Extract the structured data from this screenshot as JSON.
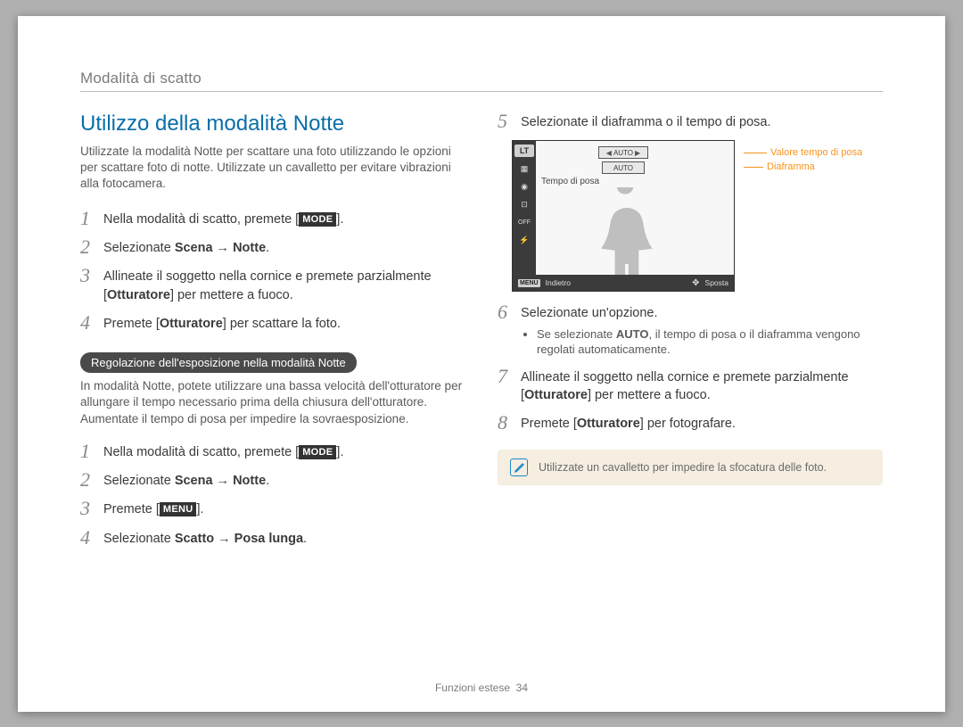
{
  "header": {
    "running_title": "Modalità di scatto"
  },
  "section": {
    "title": "Utilizzo della modalità Notte",
    "intro": "Utilizzate la modalità Notte per scattare una foto utilizzando le opzioni per scattare foto di notte. Utilizzate un cavalletto per evitare vibrazioni alla fotocamera."
  },
  "steps_a": {
    "s1": {
      "num": "1",
      "pre": "Nella modalità di scatto, premete [",
      "btn": "MODE",
      "post": "]."
    },
    "s2": {
      "num": "2",
      "pre": "Selezionate ",
      "bold": "Scena → Notte",
      "post": "."
    },
    "s3": {
      "num": "3",
      "text": "Allineate il soggetto nella cornice e premete parzialmente [",
      "bold": "Otturatore",
      "post": "] per mettere a fuoco."
    },
    "s4": {
      "num": "4",
      "pre": "Premete [",
      "bold": "Otturatore",
      "post": "] per scattare la foto."
    }
  },
  "subheading": "Regolazione dell'esposizione nella modalità Notte",
  "subtext": "In modalità Notte, potete utilizzare una bassa velocità dell'otturatore per allungare il tempo necessario prima della chiusura dell'otturatore. Aumentate il tempo di posa per impedire la sovraesposizione.",
  "steps_b": {
    "s1": {
      "num": "1",
      "pre": "Nella modalità di scatto, premete [",
      "btn": "MODE",
      "post": "]."
    },
    "s2": {
      "num": "2",
      "pre": "Selezionate ",
      "bold": "Scena → Notte",
      "post": "."
    },
    "s3": {
      "num": "3",
      "pre": "Premete [",
      "btn": "MENU",
      "post": "]."
    },
    "s4": {
      "num": "4",
      "pre": "Selezionate ",
      "bold": "Scatto → Posa lunga",
      "post": "."
    }
  },
  "steps_c": {
    "s5": {
      "num": "5",
      "text": "Selezionate il diaframma o il tempo di posa."
    },
    "s6": {
      "num": "6",
      "text": "Selezionate un'opzione.",
      "bullet_pre": "Se selezionate ",
      "bullet_bold": "AUTO",
      "bullet_post": ", il tempo di posa o il diaframma vengono regolati automaticamente."
    },
    "s7": {
      "num": "7",
      "text": "Allineate il soggetto nella cornice e premete parzialmente [",
      "bold": "Otturatore",
      "post": "] per mettere a fuoco."
    },
    "s8": {
      "num": "8",
      "pre": "Premete [",
      "bold": "Otturatore",
      "post": "] per fotografare."
    }
  },
  "lcd": {
    "lt": "LT",
    "auto1": "AUTO",
    "auto2": "AUTO",
    "exposure_label": "Tempo di posa",
    "menu": "MENU",
    "back": "Indietro",
    "move": "Sposta",
    "callout1": "Valore tempo di posa",
    "callout2": "Diaframma"
  },
  "note": "Utilizzate un cavalletto per impedire la sfocatura delle foto.",
  "footer": {
    "section": "Funzioni estese",
    "page": "34"
  }
}
